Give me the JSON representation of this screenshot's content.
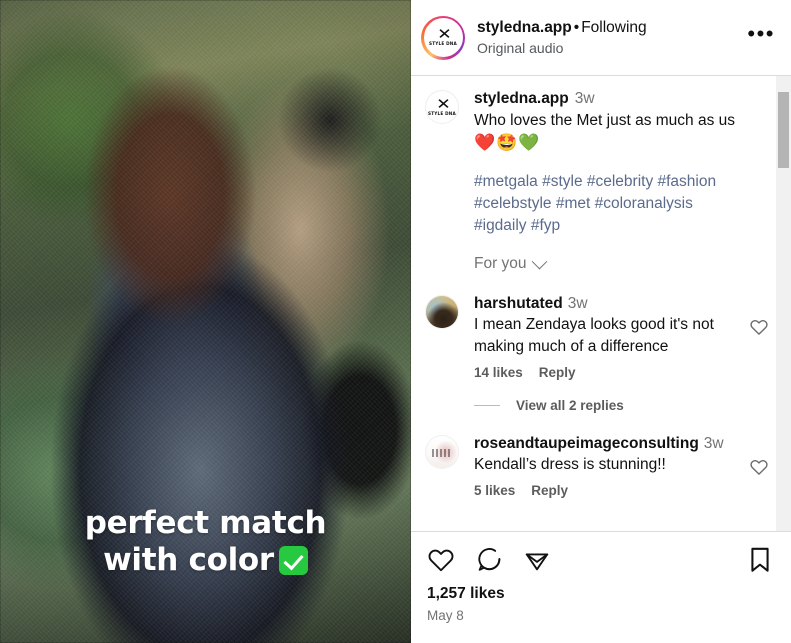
{
  "media": {
    "overlay_line1": "perfect match",
    "overlay_line2": "with color",
    "overlay_badge_icon": "green-check-badge"
  },
  "header": {
    "avatar_icon": "styledna-logo-avatar",
    "avatar_glyph": "✕",
    "avatar_wordmark": "STYLE DNA",
    "username": "styledna.app",
    "separator": "•",
    "follow_state": "Following",
    "audio": "Original audio",
    "more_icon": "•••"
  },
  "caption": {
    "avatar_icon": "styledna-logo-avatar",
    "avatar_glyph": "✕",
    "avatar_wordmark": "STYLE DNA",
    "username": "styledna.app",
    "age": "3w",
    "text": "Who loves the Met just as much as us",
    "emojis": "❤️🤩💚",
    "hashtags_line1": "#metgala #style #celebrity #fashion",
    "hashtags_line2": "#celebstyle #met #coloranalysis",
    "hashtags_line3": "#igdaily #fyp",
    "filter_label": "For you",
    "filter_chevron_icon": "chevron-down-icon"
  },
  "comments": [
    {
      "avatar_icon": "user-photo-avatar",
      "username": "harshutated",
      "age": "3w",
      "text": "I mean Zendaya looks good it's not making much of a difference",
      "likes": "14 likes",
      "reply": "Reply",
      "like_icon": "heart-outline-icon",
      "replies_link": "View all 2 replies"
    },
    {
      "avatar_icon": "rose-and-taupe-logo-avatar",
      "username": "roseandtaupeimageconsulting",
      "age": "3w",
      "text": "Kendall’s dress is stunning!!",
      "likes": "5 likes",
      "reply": "Reply",
      "like_icon": "heart-outline-icon"
    }
  ],
  "actions": {
    "like_icon": "heart-outline-icon",
    "comment_icon": "comment-bubble-icon",
    "share_icon": "share-paper-plane-icon",
    "save_icon": "bookmark-outline-icon",
    "likes_count": "1,257 likes",
    "date": "May 8"
  },
  "scrollbar": {
    "orientation": "vertical",
    "thumb_label": "comments-scroll-thumb"
  },
  "colors": {
    "accent_link": "#5b6b8c",
    "text_primary": "#111111",
    "text_muted": "#737373",
    "divider": "#dbdbdb",
    "badge_green": "#26c940",
    "scrollbar_track": "#f1f1f1",
    "scrollbar_thumb": "#b4b4b4"
  }
}
